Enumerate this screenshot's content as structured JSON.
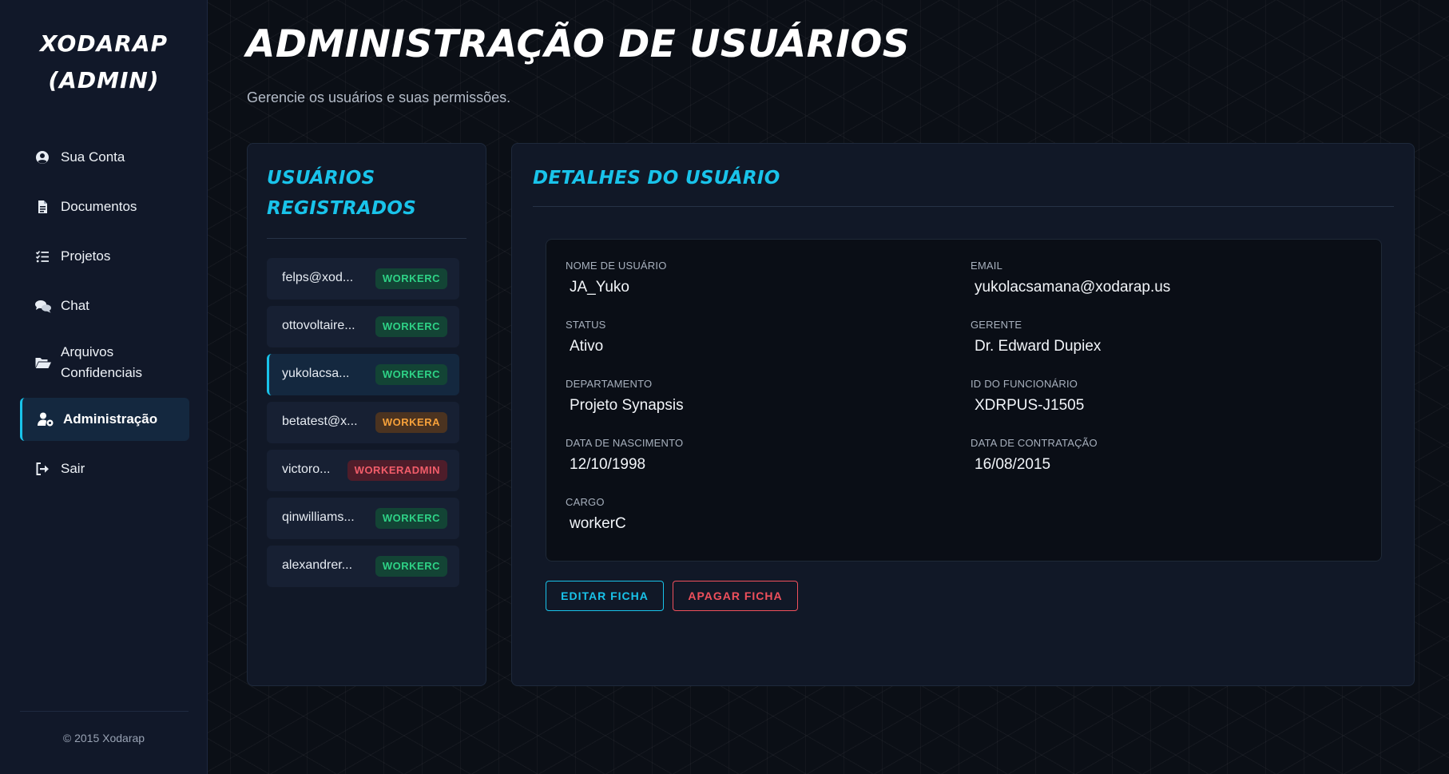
{
  "sidebar": {
    "brand_line1": "XODARAP",
    "brand_line2": "(ADMIN)",
    "items": [
      {
        "label": "Sua Conta",
        "icon": "user-circle-icon"
      },
      {
        "label": "Documentos",
        "icon": "document-icon"
      },
      {
        "label": "Projetos",
        "icon": "task-list-icon"
      },
      {
        "label": "Chat",
        "icon": "chat-bubbles-icon"
      },
      {
        "label": "Arquivos Confidenciais",
        "icon": "folder-open-icon"
      },
      {
        "label": "Administração",
        "icon": "user-gear-icon",
        "active": true
      },
      {
        "label": "Sair",
        "icon": "sign-out-icon"
      }
    ],
    "copyright": "© 2015 Xodarap"
  },
  "header": {
    "title": "ADMINISTRAÇÃO DE USUÁRIOS",
    "subtitle": "Gerencie os usuários e suas permissões."
  },
  "users_panel": {
    "title": "USUÁRIOS REGISTRADOS",
    "users": [
      {
        "email": "felps@xod...",
        "role": "WORKERC",
        "role_color": "green"
      },
      {
        "email": "ottovoltaire...",
        "role": "WORKERC",
        "role_color": "green"
      },
      {
        "email": "yukolacsa...",
        "role": "WORKERC",
        "role_color": "green",
        "selected": true
      },
      {
        "email": "betatest@x...",
        "role": "WORKERA",
        "role_color": "orange"
      },
      {
        "email": "victoro...",
        "role": "WORKERADMIN",
        "role_color": "red"
      },
      {
        "email": "qinwilliams...",
        "role": "WORKERC",
        "role_color": "green"
      },
      {
        "email": "alexandrer...",
        "role": "WORKERC",
        "role_color": "green"
      }
    ]
  },
  "details": {
    "title": "DETALHES DO USUÁRIO",
    "fields": {
      "username": {
        "label": "NOME DE USUÁRIO",
        "value": "JA_Yuko"
      },
      "email": {
        "label": "EMAIL",
        "value": "yukolacsamana@xodarap.us"
      },
      "status": {
        "label": "STATUS",
        "value": "Ativo"
      },
      "manager": {
        "label": "GERENTE",
        "value": "Dr. Edward Dupiex"
      },
      "department": {
        "label": "DEPARTAMENTO",
        "value": "Projeto Synapsis"
      },
      "employee_id": {
        "label": "ID DO FUNCIONÁRIO",
        "value": "XDRPUS-J1505"
      },
      "birth_date": {
        "label": "DATA DE NASCIMENTO",
        "value": "12/10/1998"
      },
      "hire_date": {
        "label": "DATA DE CONTRATAÇÃO",
        "value": "16/08/2015"
      },
      "role": {
        "label": "CARGO",
        "value": "workerC"
      }
    },
    "edit_label": "EDITAR FICHA",
    "delete_label": "APAGAR FICHA"
  },
  "colors": {
    "accent": "#19c3ea",
    "badge_green": "#2ed286",
    "badge_orange": "#f7a13a",
    "badge_red": "#f25d6a",
    "danger": "#f0505c"
  }
}
